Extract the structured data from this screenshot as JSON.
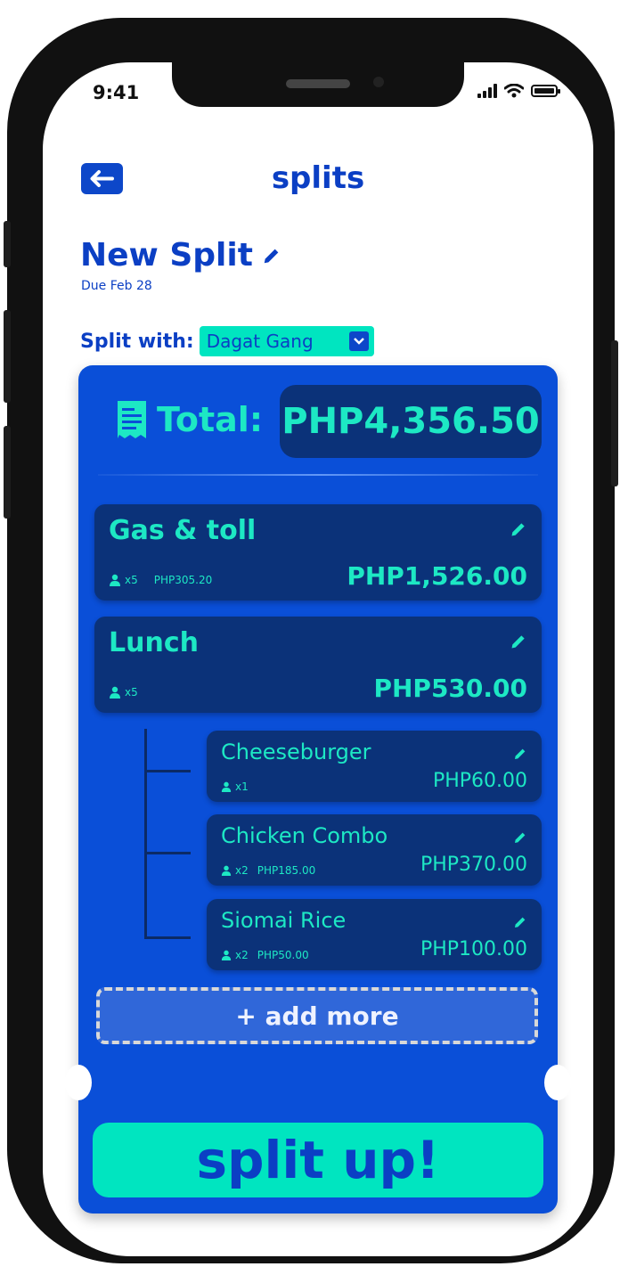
{
  "status_bar": {
    "time": "9:41"
  },
  "header": {
    "title": "splits",
    "back_icon": "arrow-left-icon"
  },
  "split": {
    "name": "New Split",
    "due": "Due Feb 28",
    "split_with_label": "Split with:",
    "group": "Dagat Gang"
  },
  "total": {
    "label": "Total:",
    "value": "PHP4,356.50",
    "icon": "receipt-icon"
  },
  "items": [
    {
      "name": "Gas & toll",
      "people": "x5",
      "per_person": "PHP305.20",
      "amount": "PHP1,526.00"
    },
    {
      "name": "Lunch",
      "people": "x5",
      "per_person": "",
      "amount": "PHP530.00"
    }
  ],
  "sub_items": [
    {
      "name": "Cheeseburger",
      "people": "x1",
      "per_person": "",
      "amount": "PHP60.00"
    },
    {
      "name": "Chicken Combo",
      "people": "x2",
      "per_person": "PHP185.00",
      "amount": "PHP370.00"
    },
    {
      "name": "Siomai Rice",
      "people": "x2",
      "per_person": "PHP50.00",
      "amount": "PHP100.00"
    }
  ],
  "actions": {
    "add_more": "+ add more",
    "split_up": "split up!"
  },
  "colors": {
    "primary": "#0b3fc4",
    "card": "#0a4fd8",
    "item": "#0b3279",
    "accent": "#1de8c4",
    "button": "#00e5c0"
  }
}
